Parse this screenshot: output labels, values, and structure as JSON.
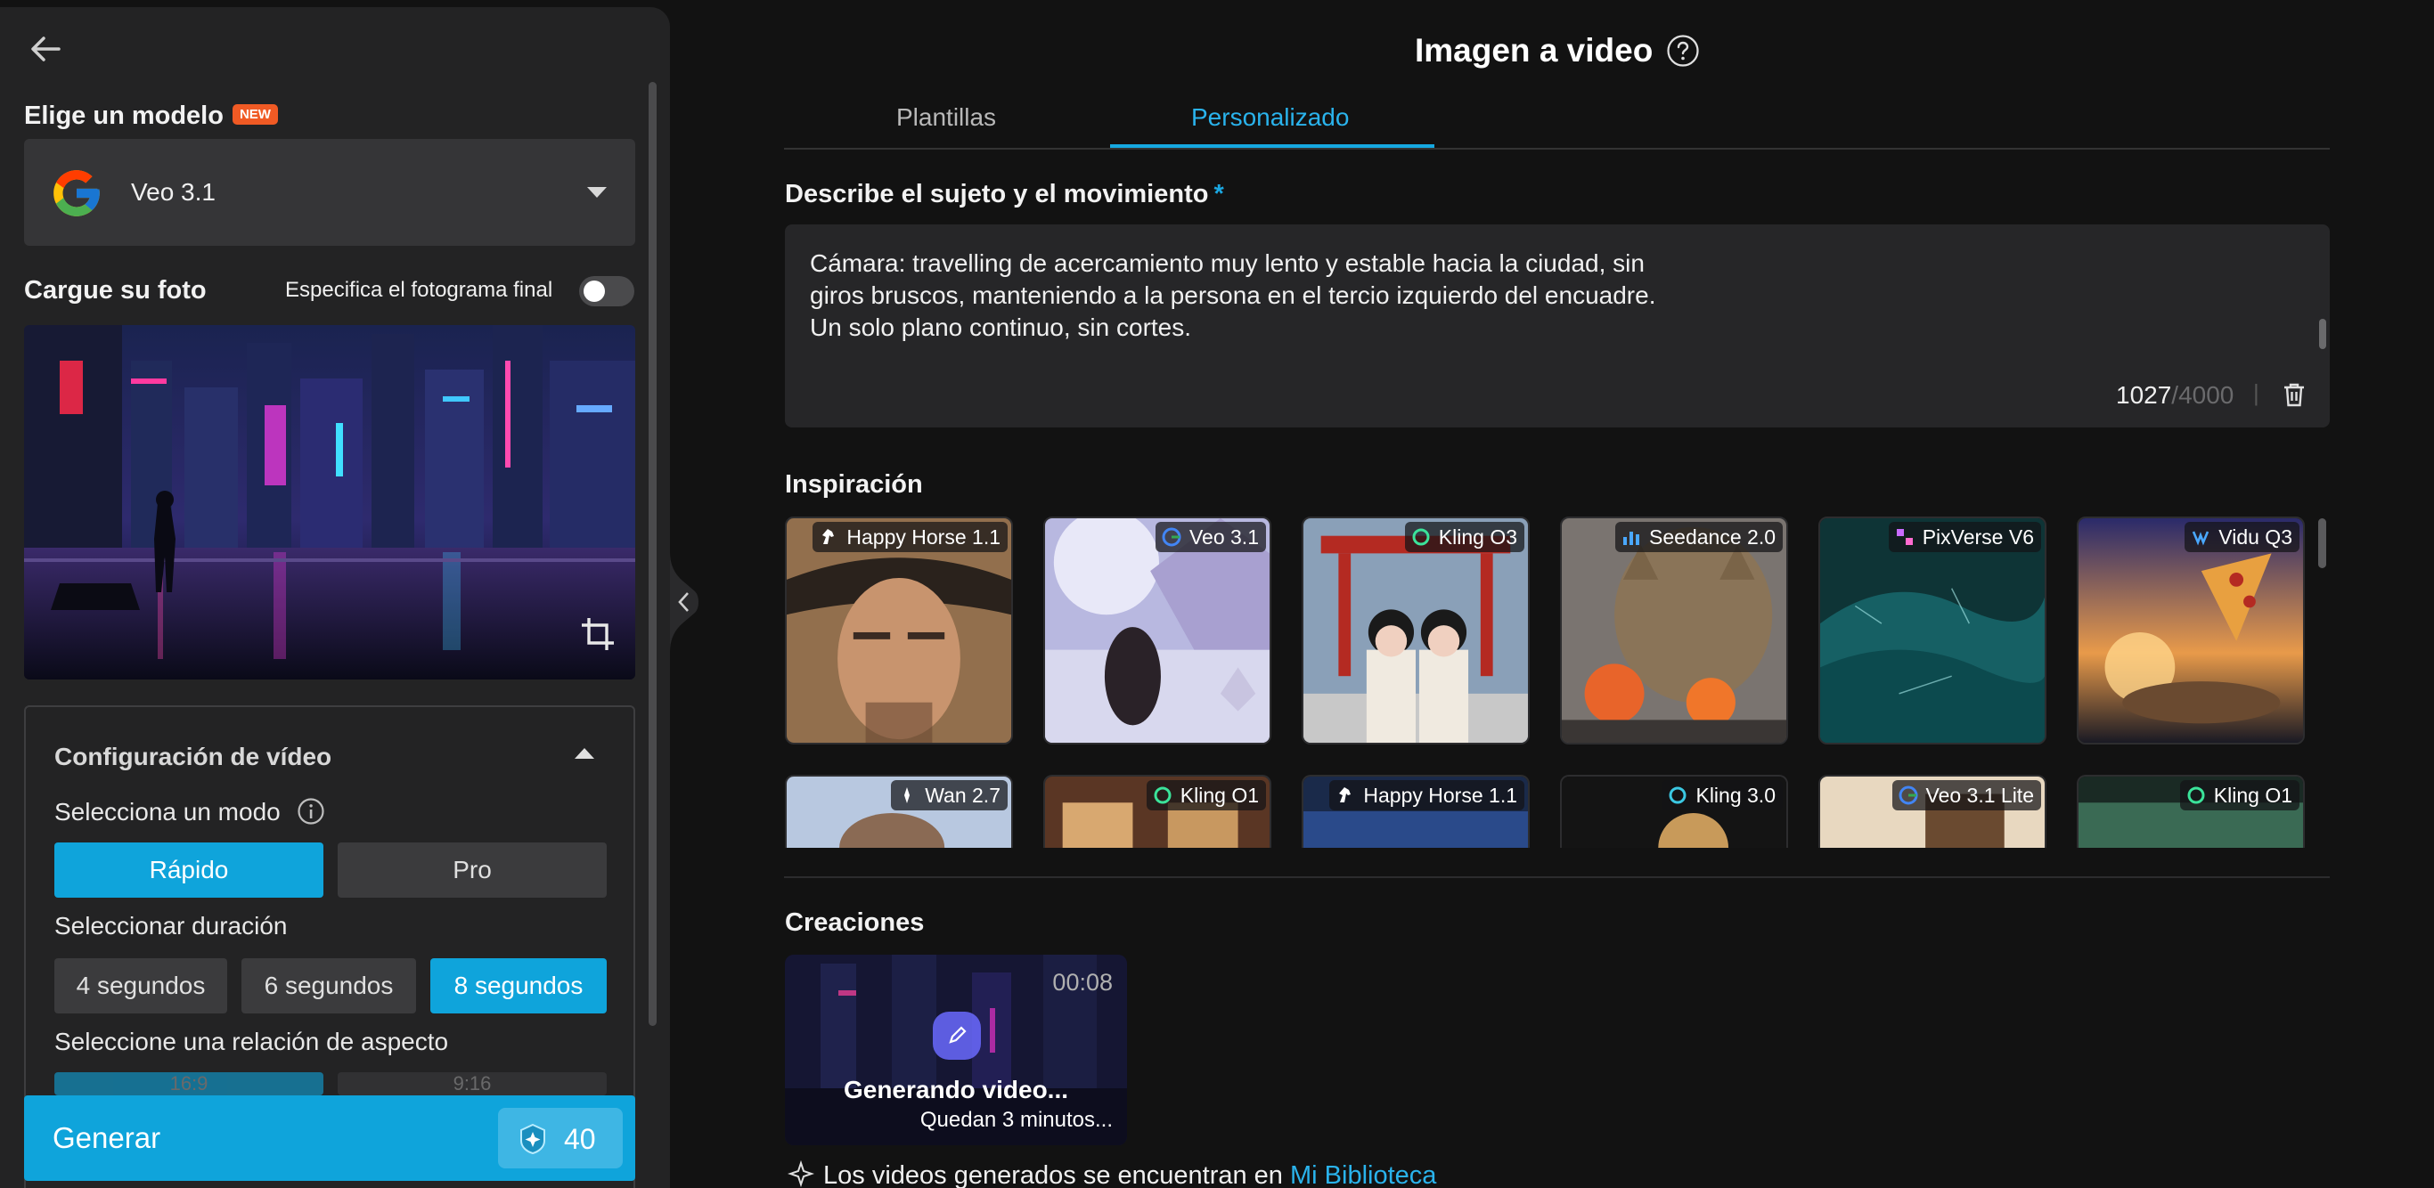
{
  "sidebar": {
    "choose_model_label": "Elige un modelo",
    "new_badge": "NEW",
    "model": {
      "name": "Veo 3.1",
      "icon": "google-icon"
    },
    "upload_label": "Cargue su foto",
    "final_frame_label": "Especifica el fotograma final",
    "final_frame_enabled": false,
    "config": {
      "title": "Configuración de vídeo",
      "mode_label": "Selecciona un modo",
      "modes": [
        "Rápido",
        "Pro"
      ],
      "selected_mode": "Rápido",
      "duration_label": "Seleccionar duración",
      "durations": [
        "4 segundos",
        "6 segundos",
        "8 segundos"
      ],
      "selected_duration": "8 segundos",
      "aspect_label": "Seleccione una relación de aspecto",
      "aspects": [
        "16:9",
        "9:16"
      ]
    },
    "generate": {
      "label": "Generar",
      "credits": "40"
    }
  },
  "main": {
    "title": "Imagen a video",
    "tabs": [
      {
        "label": "Plantillas",
        "active": false
      },
      {
        "label": "Personalizado",
        "active": true
      }
    ],
    "describe_label": "Describe el sujeto y el movimiento",
    "required_mark": "*",
    "prompt_text": "Cámara: travelling de acercamiento muy lento y estable hacia la ciudad, sin\ngiros bruscos, manteniendo a la persona en el tercio izquierdo del encuadre.\nUn solo plano continuo, sin cortes.",
    "char_count": "1027",
    "char_max": "/4000",
    "char_sep": "|",
    "inspiration_label": "Inspiración",
    "inspiration": [
      {
        "model": "Happy Horse 1.1",
        "icon": "horse-icon"
      },
      {
        "model": "Veo 3.1",
        "icon": "google-icon"
      },
      {
        "model": "Kling O3",
        "icon": "kling-icon"
      },
      {
        "model": "Seedance 2.0",
        "icon": "bars-icon"
      },
      {
        "model": "PixVerse V6",
        "icon": "pixverse-icon"
      },
      {
        "model": "Vidu Q3",
        "icon": "vidu-icon"
      },
      {
        "model": "Wan 2.7",
        "icon": "wan-icon"
      },
      {
        "model": "Kling O1",
        "icon": "kling-icon"
      },
      {
        "model": "Happy Horse 1.1",
        "icon": "horse-icon"
      },
      {
        "model": "Kling 3.0",
        "icon": "kling-icon"
      },
      {
        "model": "Veo 3.1 Lite",
        "icon": "google-icon"
      },
      {
        "model": "Kling O1",
        "icon": "kling-icon"
      }
    ],
    "creations_label": "Creaciones",
    "creation": {
      "time": "00:08",
      "status": "Generando video...",
      "remaining": "Quedan 3 minutos..."
    },
    "library_note_prefix": "Los videos generados se encuentran en",
    "library_link": "Mi Biblioteca"
  },
  "colors": {
    "accent": "#0fa4db",
    "link": "#2ab3ec",
    "badge": "#f05a24",
    "panel": "#232324",
    "background": "#121212"
  }
}
